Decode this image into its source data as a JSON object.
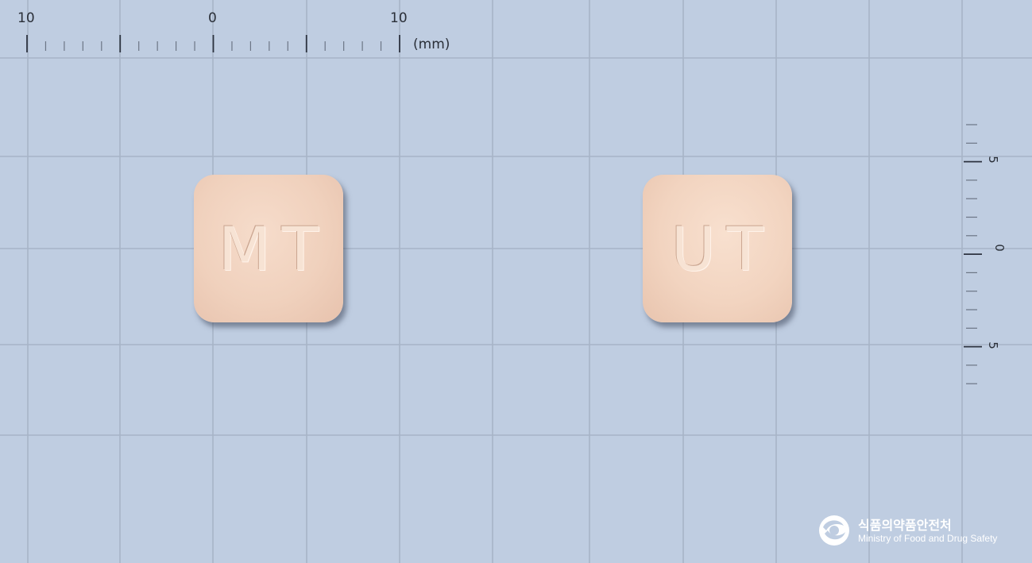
{
  "image": {
    "background_color": "#bfcde1",
    "grid_color": "#a7b4c7"
  },
  "ruler_top": {
    "labels": [
      "10",
      "0",
      "10"
    ],
    "unit": "(mm)"
  },
  "ruler_right": {
    "labels": [
      "5",
      "0",
      "5"
    ]
  },
  "pills": [
    {
      "imprint": "MT",
      "color": "#f0d1bd"
    },
    {
      "imprint": "UT",
      "color": "#f2d4c0"
    }
  ],
  "logo": {
    "name_korean": "식품의약품안전처",
    "name_english": "Ministry of Food and Drug Safety"
  }
}
